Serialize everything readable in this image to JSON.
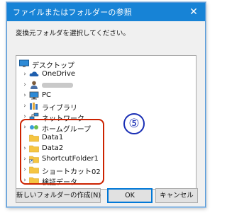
{
  "window": {
    "title": "ファイルまたはフォルダーの参照",
    "close_glyph": "✕"
  },
  "instruction": "変換元フォルダを選択してください。",
  "tree": {
    "items": [
      {
        "label": "デスクトップ",
        "icon": "desktop-icon",
        "expander": ""
      },
      {
        "label": "OneDrive",
        "icon": "cloud-icon",
        "expander": "›"
      },
      {
        "label": " ",
        "icon": "user-icon",
        "expander": "›"
      },
      {
        "label": "PC",
        "icon": "pc-icon",
        "expander": "›"
      },
      {
        "label": "ライブラリ",
        "icon": "library-icon",
        "expander": "›"
      },
      {
        "label": "ネットワーク",
        "icon": "network-icon",
        "expander": "›"
      },
      {
        "label": "ホームグループ",
        "icon": "homegroup-icon",
        "expander": "›"
      },
      {
        "label": "Data1",
        "icon": "folder-icon",
        "expander": ""
      },
      {
        "label": "Data2",
        "icon": "folder-icon",
        "expander": "›"
      },
      {
        "label": "ShortcutFolder1",
        "icon": "shortcut-folder-icon",
        "expander": "›"
      },
      {
        "label": "ショートカット02",
        "icon": "folder-icon",
        "expander": "›"
      },
      {
        "label": "検証データ",
        "icon": "folder-icon",
        "expander": "›"
      }
    ]
  },
  "buttons": {
    "new_folder": "新しいフォルダーの作成(N)",
    "ok": "OK",
    "cancel": "キャンセル"
  },
  "annotation": {
    "marker": "⑤",
    "color": "#cc2200"
  },
  "colors": {
    "title_bar": "#1783d6",
    "folder": "#f5c542",
    "selection": "#cce8ff"
  }
}
